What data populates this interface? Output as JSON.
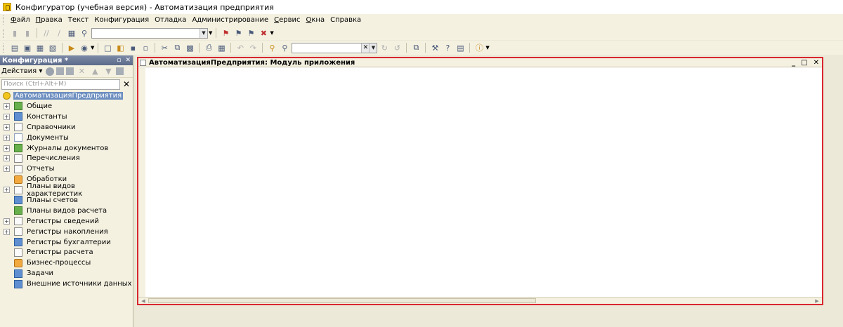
{
  "window": {
    "title": "Конфигуратор (учебная версия) - Автоматизация предприятия"
  },
  "menu": [
    {
      "label": "Файл",
      "ul": "Ф",
      "rest": "айл"
    },
    {
      "label": "Правка",
      "ul": "П",
      "rest": "равка"
    },
    {
      "label": "Текст",
      "ul": "",
      "rest": "Текст"
    },
    {
      "label": "Конфигурация",
      "ul": "",
      "rest": "Конфигурация"
    },
    {
      "label": "Отладка",
      "ul": "",
      "rest": "Отладка"
    },
    {
      "label": "Администрирование",
      "ul": "",
      "rest": "Администрирование"
    },
    {
      "label": "Сервис",
      "ul": "С",
      "rest": "ервис"
    },
    {
      "label": "Окна",
      "ul": "О",
      "rest": "кна"
    },
    {
      "label": "Справка",
      "ul": "",
      "rest": "Справка"
    }
  ],
  "config_panel": {
    "title": "Конфигурация *",
    "pin": "▫",
    "close": "✕",
    "actions_label": "Действия",
    "search_placeholder": "Поиск (Ctrl+Alt+M)",
    "search_clear": "✕",
    "root_label": "АвтоматизацияПредприятия",
    "items": [
      {
        "label": "Общие",
        "expandable": true
      },
      {
        "label": "Константы",
        "expandable": true
      },
      {
        "label": "Справочники",
        "expandable": true
      },
      {
        "label": "Документы",
        "expandable": true
      },
      {
        "label": "Журналы документов",
        "expandable": true
      },
      {
        "label": "Перечисления",
        "expandable": true
      },
      {
        "label": "Отчеты",
        "expandable": true
      },
      {
        "label": "Обработки",
        "expandable": false
      },
      {
        "label": "Планы видов характеристик",
        "expandable": true
      },
      {
        "label": "Планы счетов",
        "expandable": false
      },
      {
        "label": "Планы видов расчета",
        "expandable": false
      },
      {
        "label": "Регистры сведений",
        "expandable": true
      },
      {
        "label": "Регистры накопления",
        "expandable": true
      },
      {
        "label": "Регистры бухгалтерии",
        "expandable": false
      },
      {
        "label": "Регистры расчета",
        "expandable": false
      },
      {
        "label": "Бизнес-процессы",
        "expandable": false
      },
      {
        "label": "Задачи",
        "expandable": false
      },
      {
        "label": "Внешние источники данных",
        "expandable": false
      }
    ]
  },
  "document": {
    "title": "АвтоматизацияПредприятия: Модуль приложения",
    "minimize": "_",
    "maximize": "□",
    "close": "✕"
  },
  "colors": {
    "highlight_border": "#d9262f",
    "selection": "#6e8fc0"
  }
}
